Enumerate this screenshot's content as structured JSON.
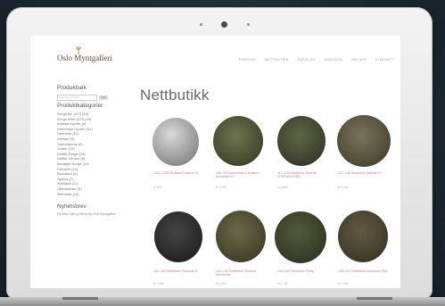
{
  "site": {
    "logo_text": "Oslo Myntgalleri",
    "nav": [
      "FORSIDE",
      "NETTBUTIKK",
      "KATALOG",
      "AUKSJON",
      "OM OSS",
      "KONTAKT"
    ]
  },
  "sidebar": {
    "search_heading": "Produktsøk",
    "search_placeholder": "Søk etter produkt",
    "search_button": "Søk",
    "categories_heading": "Produktkategorier",
    "categories": [
      "Norge før 1873 (44)",
      "Norge etter 1873 (15)",
      "Antikke mynter (8)",
      "Romerske mynter (31)",
      "Danmark (11)",
      "Sverige (5)",
      "Storbritannia (5)",
      "Sedler (15)",
      "Sedler Norge (24)",
      "Sedler Verden (8)",
      "Medaljer Norge (13)",
      "Preusen (12)",
      "Russland (4)",
      "Spania (7)",
      "Tyskland (11)",
      "Gjenstander (5)",
      "Rekvisita (10)"
    ],
    "news_heading": "Nyhetsbrev",
    "news_text": "Få siste nytt og tilbud fra Oslo Myntgalleri"
  },
  "main": {
    "title": "Nettbutikk",
    "products": [
      {
        "caption": "1202–1280 Brakteat Haakon IV",
        "price": "kr 600"
      },
      {
        "caption": "286–305 Antoninian Carausius Alexander IV",
        "price": "kr 1 200"
      },
      {
        "caption": "117–138 Sestertius Hadrian FORTUNA RED",
        "price": "kr 2 800"
      },
      {
        "caption": "117–138 Sestertius Hadrian IV",
        "price": "kr 2 400"
      },
      {
        "caption": "161–180 Sestertius Faustina II",
        "price": "kr 1 900"
      },
      {
        "caption": "222–235 Sestertius Severus Alexander",
        "price": "kr 1 500"
      },
      {
        "caption": "244–249 Sestertius Philip I",
        "price": "kr 1 700"
      },
      {
        "caption": "138–161 Sestertius Antoninus Pius",
        "price": "kr 2 100"
      }
    ]
  },
  "colors": {
    "background": "#1f2c33",
    "caption_link": "#d07a7a",
    "title": "#6a6a6a"
  }
}
